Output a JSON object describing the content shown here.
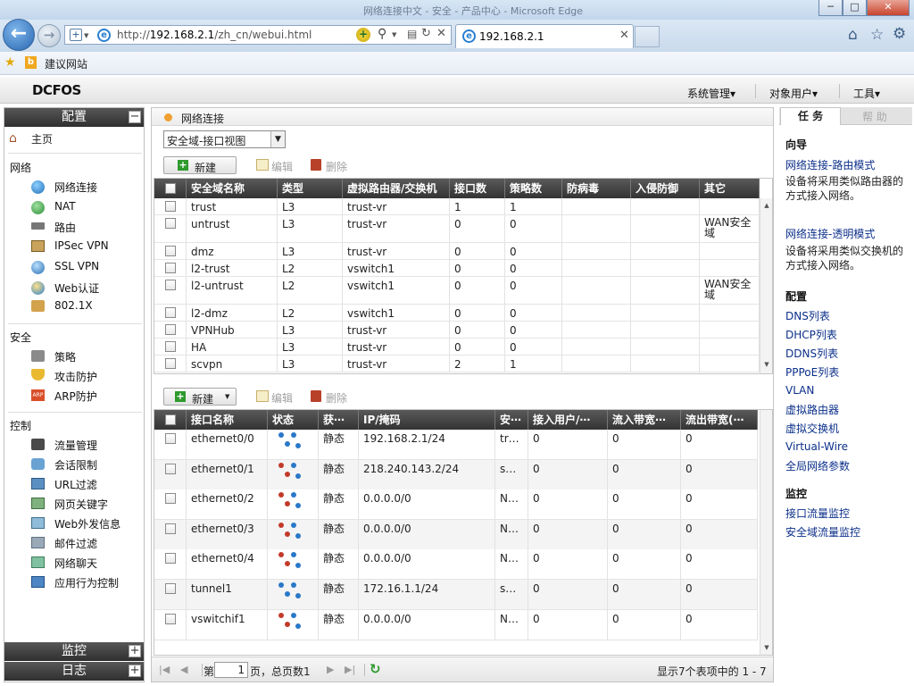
{
  "browser": {
    "window_title": "网络连接中文 - 安全 - 产品中心 - Microsoft Edge",
    "address": "http://192.168.2.1/zh_cn/webui.html",
    "address_host": "192.168.2.1",
    "address_path": "/zh_cn/webui.html",
    "address_prefix": "http://",
    "tab_title": "192.168.2.1",
    "favorites_label": "建议网站",
    "win_minimize": "─",
    "win_maximize": "□",
    "win_close": "✕"
  },
  "app": {
    "logo": "DCFOS",
    "menus": [
      "系统管理▾",
      "对象用户▾",
      "工具▾"
    ]
  },
  "sidebar": {
    "config_title": "配置",
    "config_toggle": "−",
    "home": "主页",
    "sections": [
      {
        "title": "网络",
        "items": [
          "网络连接",
          "NAT",
          "路由",
          "IPSec VPN",
          "SSL VPN",
          "Web认证",
          "802.1X"
        ]
      },
      {
        "title": "安全",
        "items": [
          "策略",
          "攻击防护",
          "ARP防护"
        ]
      },
      {
        "title": "控制",
        "items": [
          "流量管理",
          "会话限制",
          "URL过滤",
          "网页关键字",
          "Web外发信息",
          "邮件过滤",
          "网络聊天",
          "应用行为控制"
        ]
      }
    ],
    "monitor_title": "监控",
    "log_title": "日志",
    "expand": "+"
  },
  "main": {
    "breadcrumb": "网络连接",
    "view_select": "安全域-接口视图",
    "toolbar": {
      "new": "新建",
      "edit": "编辑",
      "delete": "删除"
    },
    "zone_table": {
      "headers": [
        "安全域名称",
        "类型",
        "虚拟路由器/交换机",
        "接口数",
        "策略数",
        "防病毒",
        "入侵防御",
        "其它"
      ],
      "rows": [
        [
          "trust",
          "L3",
          "trust-vr",
          "1",
          "1",
          "",
          "",
          ""
        ],
        [
          "untrust",
          "L3",
          "trust-vr",
          "0",
          "0",
          "",
          "",
          "WAN安全域"
        ],
        [
          "dmz",
          "L3",
          "trust-vr",
          "0",
          "0",
          "",
          "",
          ""
        ],
        [
          "l2-trust",
          "L2",
          "vswitch1",
          "0",
          "0",
          "",
          "",
          ""
        ],
        [
          "l2-untrust",
          "L2",
          "vswitch1",
          "0",
          "0",
          "",
          "",
          "WAN安全域"
        ],
        [
          "l2-dmz",
          "L2",
          "vswitch1",
          "0",
          "0",
          "",
          "",
          ""
        ],
        [
          "VPNHub",
          "L3",
          "trust-vr",
          "0",
          "0",
          "",
          "",
          ""
        ],
        [
          "HA",
          "L3",
          "trust-vr",
          "0",
          "0",
          "",
          "",
          ""
        ],
        [
          "scvpn",
          "L3",
          "trust-vr",
          "2",
          "1",
          "",
          "",
          ""
        ]
      ]
    },
    "interface_table": {
      "headers": [
        "接口名称",
        "状态",
        "获⋯",
        "IP/掩码",
        "安⋯",
        "接入用户/⋯",
        "流入带宽⋯",
        "流出带宽(⋯"
      ],
      "rows": [
        {
          "name": "ethernet0/0",
          "status": "up",
          "mode": "静态",
          "ip": "192.168.2.1/24",
          "zone": "tr…",
          "users": "0",
          "in": "0",
          "out": "0"
        },
        {
          "name": "ethernet0/1",
          "status": "down",
          "mode": "静态",
          "ip": "218.240.143.2/24",
          "zone": "s…",
          "users": "0",
          "in": "0",
          "out": "0"
        },
        {
          "name": "ethernet0/2",
          "status": "down",
          "mode": "静态",
          "ip": "0.0.0.0/0",
          "zone": "N…",
          "users": "0",
          "in": "0",
          "out": "0"
        },
        {
          "name": "ethernet0/3",
          "status": "down",
          "mode": "静态",
          "ip": "0.0.0.0/0",
          "zone": "N…",
          "users": "0",
          "in": "0",
          "out": "0"
        },
        {
          "name": "ethernet0/4",
          "status": "down",
          "mode": "静态",
          "ip": "0.0.0.0/0",
          "zone": "N…",
          "users": "0",
          "in": "0",
          "out": "0"
        },
        {
          "name": "tunnel1",
          "status": "up",
          "mode": "静态",
          "ip": "172.16.1.1/24",
          "zone": "s…",
          "users": "0",
          "in": "0",
          "out": "0"
        },
        {
          "name": "vswitchif1",
          "status": "down",
          "mode": "静态",
          "ip": "0.0.0.0/0",
          "zone": "N…",
          "users": "0",
          "in": "0",
          "out": "0"
        }
      ]
    },
    "pagination": {
      "page_prefix": "第",
      "page_value": "1",
      "page_suffix": "页，总页数1",
      "summary": "显示7个表项中的 1 - 7"
    }
  },
  "taskpanel": {
    "tab_task": "任 务",
    "tab_help": "帮 助",
    "wizard_title": "向导",
    "wizard_items": [
      {
        "link": "网络连接-路由模式",
        "desc": "设备将采用类似路由器的方式接入网络。"
      },
      {
        "link": "网络连接-透明模式",
        "desc": "设备将采用类似交换机的方式接入网络。"
      }
    ],
    "config_title": "配置",
    "config_links": [
      "DNS列表",
      "DHCP列表",
      "DDNS列表",
      "PPPoE列表",
      "VLAN",
      "虚拟路由器",
      "虚拟交换机",
      "Virtual-Wire",
      "全局网络参数"
    ],
    "monitor_title": "监控",
    "monitor_links": [
      "接口流量监控",
      "安全域流量监控"
    ]
  }
}
